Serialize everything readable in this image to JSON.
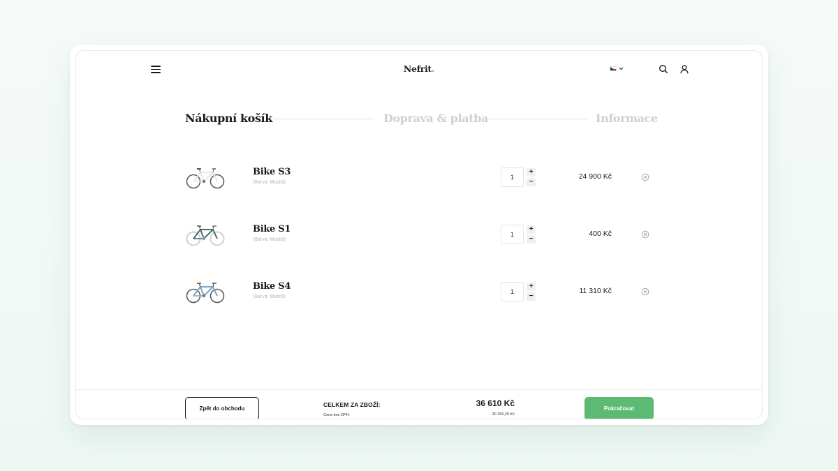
{
  "header": {
    "logo_text": "Nefrit",
    "logo_dot": ".",
    "language_flag": "czech-flag-icon",
    "icons": [
      "menu-icon",
      "search-icon",
      "user-icon",
      "chevron-down-icon"
    ]
  },
  "steps": [
    {
      "label": "Nákupní košík",
      "active": true
    },
    {
      "label": "Doprava & platba",
      "active": false
    },
    {
      "label": "Informace",
      "active": false
    }
  ],
  "cart": {
    "items": [
      {
        "name": "Bike S3",
        "variant": "(Barva: Modrá)",
        "quantity": "1",
        "price": "24 900 Kč",
        "frame_color": "#e8e8e8"
      },
      {
        "name": "Bike S1",
        "variant": "(Barva: Modrá)",
        "quantity": "1",
        "price": "400 Kč",
        "frame_color": "#4a6b73"
      },
      {
        "name": "Bike S4",
        "variant": "(Barva: Modrá)",
        "quantity": "1",
        "price": "11 310 Kč",
        "frame_color": "#86a9c9"
      }
    ],
    "plus_label": "+",
    "minus_label": "−"
  },
  "footer": {
    "back_label": "Zpět do obchodu",
    "total_label": "CELKEM ZA ZBOŽÍ:",
    "net_label": "Cena bez DPH:",
    "total_value": "36 610 Kč",
    "net_value": "30 256,20 Kč",
    "continue_label": "Pokračovat"
  },
  "colors": {
    "accent": "#5dba72",
    "logo_dot": "#4fb56e",
    "inactive_step": "#cfcfcf"
  }
}
